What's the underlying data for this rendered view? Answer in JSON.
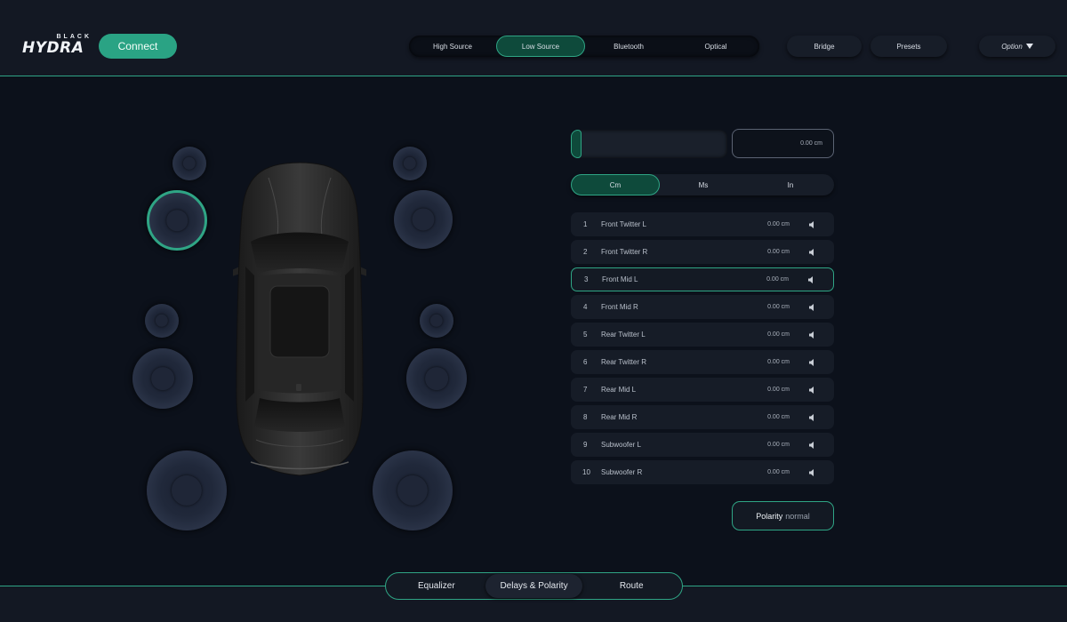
{
  "header": {
    "logo_small": "BLACK",
    "logo_big": "HYDRA",
    "connect_label": "Connect",
    "sources": [
      {
        "label": "High Source",
        "active": false
      },
      {
        "label": "Low Source",
        "active": true
      },
      {
        "label": "Bluetooth",
        "active": false
      },
      {
        "label": "Optical",
        "active": false
      }
    ],
    "bridge_label": "Bridge",
    "presets_label": "Presets",
    "option_label": "Option"
  },
  "delay": {
    "level": 0.0,
    "value_display": "0.00 cm",
    "units": [
      {
        "label": "Cm",
        "active": true
      },
      {
        "label": "Ms",
        "active": false
      },
      {
        "label": "In",
        "active": false
      }
    ]
  },
  "channels": [
    {
      "num": "1",
      "name": "Front Twitter L",
      "value": "0.00 cm"
    },
    {
      "num": "2",
      "name": "Front Twitter R",
      "value": "0.00 cm"
    },
    {
      "num": "3",
      "name": "Front Mid L",
      "value": "0.00 cm"
    },
    {
      "num": "4",
      "name": "Front Mid R",
      "value": "0.00 cm"
    },
    {
      "num": "5",
      "name": "Rear Twitter L",
      "value": "0.00 cm"
    },
    {
      "num": "6",
      "name": "Rear Twitter R",
      "value": "0.00 cm"
    },
    {
      "num": "7",
      "name": "Rear Mid L",
      "value": "0.00 cm"
    },
    {
      "num": "8",
      "name": "Rear Mid R",
      "value": "0.00 cm"
    },
    {
      "num": "9",
      "name": "Subwoofer L",
      "value": "0.00 cm"
    },
    {
      "num": "10",
      "name": "Subwoofer R",
      "value": "0.00 cm"
    }
  ],
  "selected_channel": "3",
  "polarity": {
    "label": "Polarity",
    "value": "normal"
  },
  "bottom_nav": [
    {
      "label": "Equalizer",
      "active": false
    },
    {
      "label": "Delays & Polarity",
      "active": true
    },
    {
      "label": "Route",
      "active": false
    }
  ],
  "colors": {
    "accent": "#2fa585",
    "accent_dark": "#0e4a3b",
    "background": "#0c111b"
  },
  "icons": {
    "mute": "speaker-icon",
    "dropdown": "triangle-down-icon"
  }
}
